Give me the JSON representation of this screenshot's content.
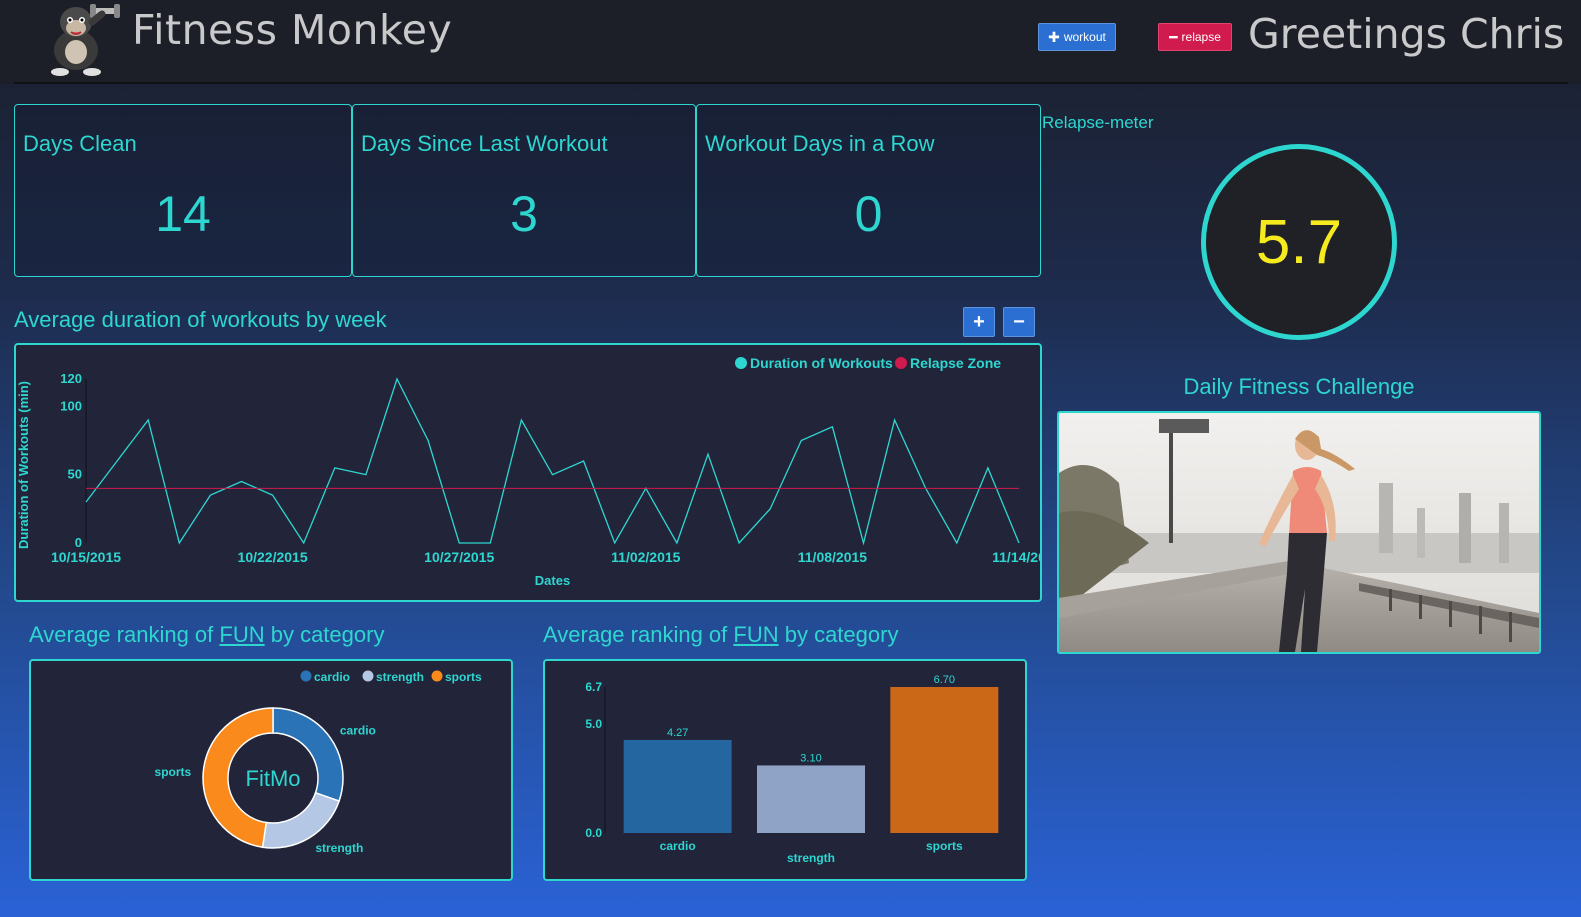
{
  "header": {
    "app_title": "Fitness Monkey",
    "logo_icon": "gorilla-dumbbell-logo",
    "workout_button": "workout",
    "relapse_button": "relapse",
    "greeting": "Greetings Chris"
  },
  "stats": [
    {
      "label": "Days Clean",
      "value": "14"
    },
    {
      "label": "Days Since Last Workout",
      "value": "3"
    },
    {
      "label": "Workout Days in a Row",
      "value": "0"
    }
  ],
  "relapse_meter": {
    "label": "Relapse-meter",
    "value": "5.7",
    "ring_color": "#2ed6d0",
    "value_color": "#f4ea1e"
  },
  "daily_challenge": {
    "title": "Daily Fitness Challenge",
    "image_icon": "woman-running-photo"
  },
  "line_chart_section": {
    "title": "Average duration of workouts by week",
    "zoom_in": "+",
    "zoom_out": "−"
  },
  "pie_section": {
    "title_prefix": "Average ranking of ",
    "title_fun": "FUN",
    "title_suffix": " by category",
    "center_label": "FitMo"
  },
  "bar_section": {
    "title_prefix": "Average ranking of ",
    "title_fun": "FUN",
    "title_suffix": " by category"
  },
  "colors": {
    "accent": "#2ed6d0",
    "relapse": "#d11a4e",
    "workout_btn": "#2a6fd1"
  },
  "chart_data": [
    {
      "type": "line",
      "title": "",
      "xlabel": "Dates",
      "ylabel": "Duration of Workouts (min)",
      "ylim": [
        0,
        120
      ],
      "yticks": [
        "0",
        "50",
        "100",
        "120"
      ],
      "xticks": [
        "10/15/2015",
        "10/22/2015",
        "10/27/2015",
        "11/02/2015",
        "11/08/2015",
        "11/14/20"
      ],
      "legend": [
        "Duration of Workouts",
        "Relapse Zone"
      ],
      "legend_position": "top-right",
      "series": [
        {
          "name": "Duration of Workouts",
          "color": "#2ed6d0",
          "values": [
            30,
            60,
            90,
            0,
            35,
            45,
            35,
            0,
            55,
            50,
            120,
            75,
            0,
            0,
            90,
            50,
            60,
            0,
            40,
            0,
            65,
            0,
            25,
            75,
            85,
            0,
            90,
            40,
            0,
            55,
            0
          ]
        },
        {
          "name": "Relapse Zone",
          "color": "#d11a4e",
          "values": [
            40,
            40,
            40,
            40,
            40,
            40,
            40,
            40,
            40,
            40,
            40,
            40,
            40,
            40,
            40,
            40,
            40,
            40,
            40,
            40,
            40,
            40,
            40,
            40,
            40,
            40,
            40,
            40,
            40,
            40,
            40
          ]
        }
      ]
    },
    {
      "type": "pie",
      "categories": [
        "cardio",
        "strength",
        "sports"
      ],
      "values": [
        4.27,
        3.1,
        6.7
      ],
      "colors": [
        "#2a73b6",
        "#b4c8e6",
        "#fb8a1d"
      ],
      "legend": [
        "cardio",
        "strength",
        "sports"
      ],
      "legend_position": "top-right"
    },
    {
      "type": "bar",
      "categories": [
        "cardio",
        "strength",
        "sports"
      ],
      "values": [
        4.27,
        3.1,
        6.7
      ],
      "value_labels": [
        "4.27",
        "3.10",
        "6.70"
      ],
      "colors": [
        "#2366a0",
        "#8fa3c6",
        "#ca6818"
      ],
      "ylim": [
        0,
        6.7
      ],
      "yticks": [
        "0.0",
        "5.0",
        "6.7"
      ]
    }
  ]
}
